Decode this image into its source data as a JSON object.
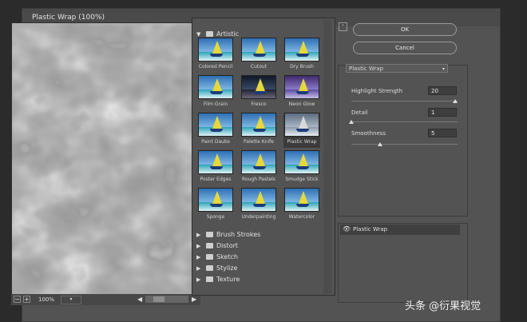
{
  "title": "Plastic Wrap (100%)",
  "preview": {
    "zoom": "100%",
    "minus": "−",
    "plus": "+"
  },
  "gallery": {
    "open_category": "Artistic",
    "thumbnails": [
      {
        "label": "Colored Pencil",
        "style": "sea"
      },
      {
        "label": "Cutout",
        "style": "sea"
      },
      {
        "label": "Dry Brush",
        "style": "sea"
      },
      {
        "label": "Film Grain",
        "style": "sea"
      },
      {
        "label": "Fresco",
        "style": "dark"
      },
      {
        "label": "Neon Glow",
        "style": "purple"
      },
      {
        "label": "Paint Daubs",
        "style": "sea"
      },
      {
        "label": "Palette Knife",
        "style": "sea"
      },
      {
        "label": "Plastic Wrap",
        "style": "gray",
        "selected": true
      },
      {
        "label": "Poster Edges",
        "style": "sea"
      },
      {
        "label": "Rough Pastels",
        "style": "sea"
      },
      {
        "label": "Smudge Stick",
        "style": "sea"
      },
      {
        "label": "Sponge",
        "style": "sea"
      },
      {
        "label": "Underpainting",
        "style": "sea"
      },
      {
        "label": "Watercolor",
        "style": "sea"
      }
    ],
    "collapsed_categories": [
      "Brush Strokes",
      "Distort",
      "Sketch",
      "Stylize",
      "Texture"
    ]
  },
  "buttons": {
    "ok": "OK",
    "cancel": "Cancel"
  },
  "settings": {
    "filter": "Plastic Wrap",
    "highlight_strength": {
      "label": "Highlight Strength",
      "value": "20",
      "level": 1.0
    },
    "detail": {
      "label": "Detail",
      "value": "1",
      "level": 0.0
    },
    "smoothness": {
      "label": "Smoothness",
      "value": "5",
      "level": 0.28
    }
  },
  "layers": [
    {
      "name": "Plastic Wrap"
    }
  ],
  "watermark": "头条 @衍果视觉"
}
